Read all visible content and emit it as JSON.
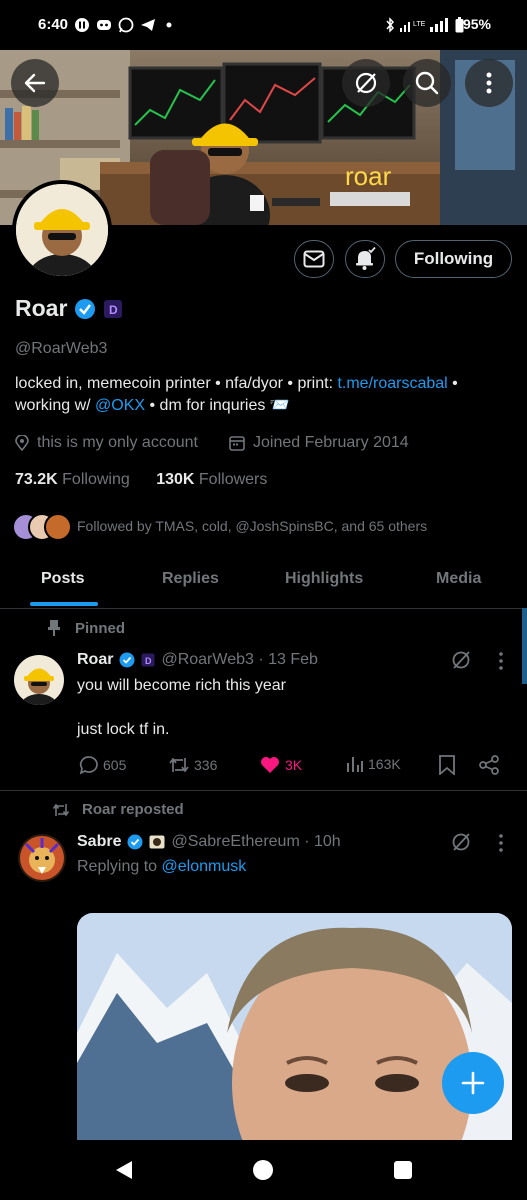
{
  "status_bar": {
    "time": "6:40",
    "battery": "95%",
    "icons": [
      "pause-icon",
      "discord-icon",
      "whatsapp-icon",
      "telegram-icon",
      "dot-icon",
      "bluetooth-icon",
      "signal-icon",
      "lte-icon"
    ]
  },
  "banner": {
    "sign_text": "roar"
  },
  "header": {
    "back": "back-arrow-icon",
    "grok": "grok-icon",
    "search": "search-icon",
    "more": "more-vertical-icon"
  },
  "profile": {
    "name": "Roar",
    "handle": "@RoarWeb3",
    "bio_part1": "locked in, memecoin printer • nfa/dyor • print: ",
    "bio_link": "t.me/roarscabal",
    "bio_part2": " • working w/ ",
    "bio_mention": "@OKX",
    "bio_part3": " • dm for inquries 📨",
    "location": "this is my only account",
    "joined": "Joined February 2014",
    "following_count": "73.2K",
    "following_label": "Following",
    "followers_count": "130K",
    "followers_label": "Followers",
    "followed_by": "Followed by TMAS, cold, @JoshSpinsBC, and 65 others",
    "follow_button": "Following"
  },
  "tabs": [
    "Posts",
    "Replies",
    "Highlights",
    "Media"
  ],
  "pinned_tweet": {
    "pinned_label": "Pinned",
    "name": "Roar",
    "handle_time": "@RoarWeb3 · 13 Feb",
    "line1": "you will become rich this year",
    "line2": "just lock tf in.",
    "replies": "605",
    "retweets": "336",
    "likes": "3K",
    "views": "163K",
    "like_color": "#f91880"
  },
  "repost": {
    "repost_label": "Roar reposted",
    "name": "Sabre",
    "handle_time": "@SabreEthereum · 10h",
    "replying_prefix": "Replying to ",
    "replying_to": "@elonmusk"
  },
  "colors": {
    "accent": "#1d9bf0",
    "verified": "#1d9bf0",
    "affiliate_badge": "#7856ff"
  }
}
